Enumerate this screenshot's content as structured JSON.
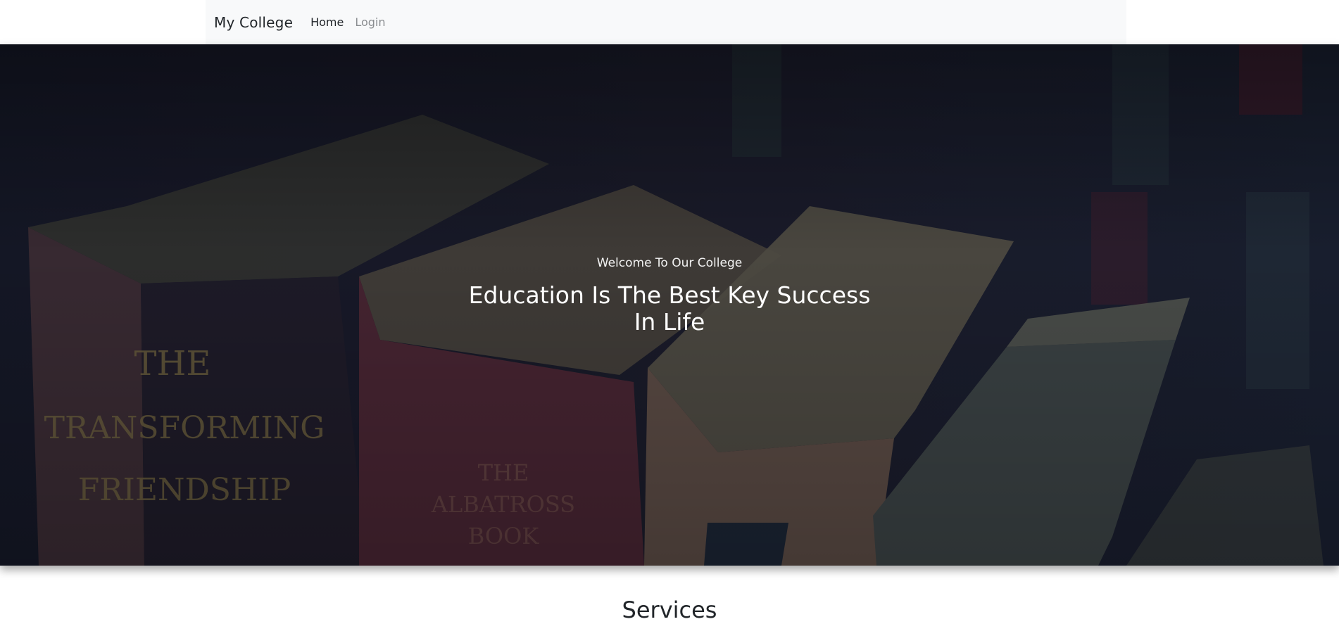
{
  "navbar": {
    "brand": "My College",
    "links": [
      {
        "label": "Home",
        "active": true
      },
      {
        "label": "Login",
        "active": false
      }
    ]
  },
  "hero": {
    "subtitle": "Welcome To Our College",
    "title": "Education Is The Best Key Success In Life"
  },
  "services": {
    "heading": "Services"
  },
  "colors": {
    "navbar_bg": "#f8f9fa",
    "hero_overlay": "#1a1b2b",
    "text_dark": "#212529",
    "text_muted": "#8a8d90"
  }
}
